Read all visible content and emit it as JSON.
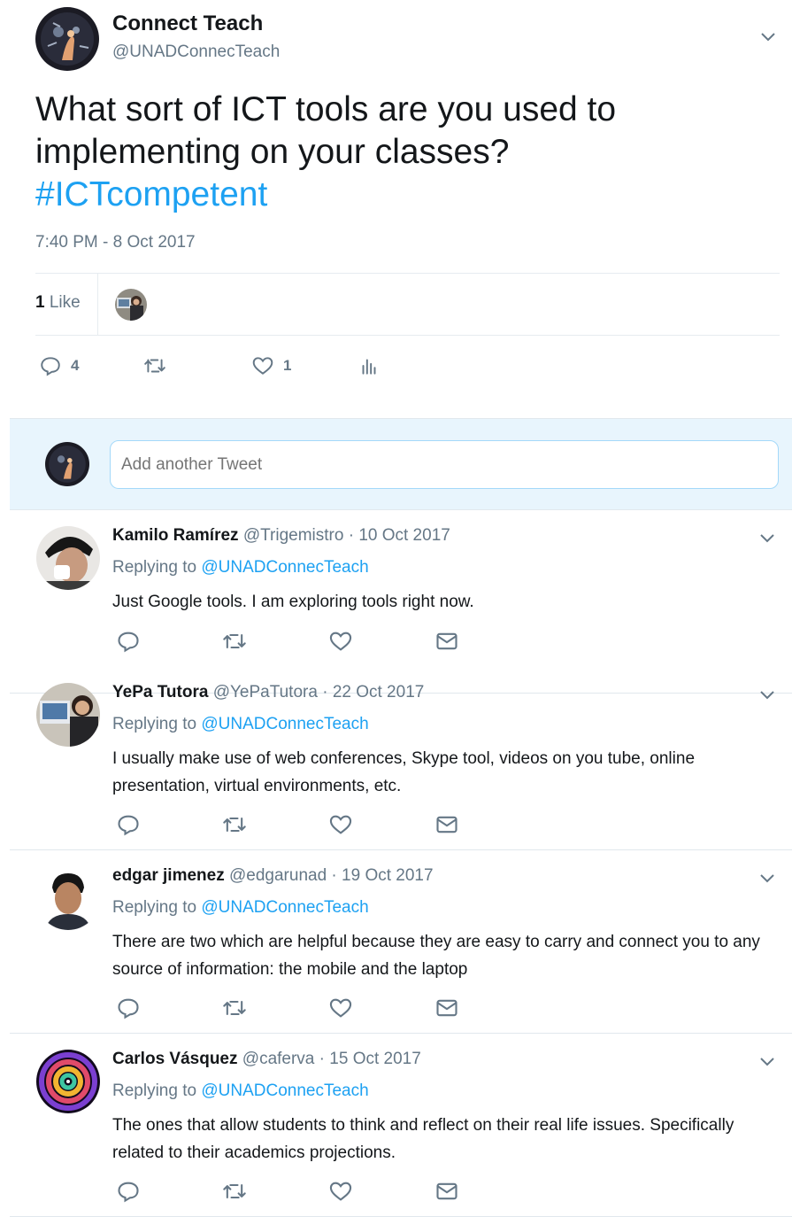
{
  "main_tweet": {
    "author_name": "Connect Teach",
    "author_handle": "@UNADConnecTeach",
    "text": "What sort of ICT tools are you used to implementing on your classes?",
    "hashtag": "#ICTcompetent",
    "timestamp": "7:40 PM - 8 Oct 2017",
    "likes_number": "1",
    "likes_label": " Like",
    "reply_count": "4",
    "like_count": "1"
  },
  "compose": {
    "placeholder": "Add another Tweet"
  },
  "replies": [
    {
      "name": "Kamilo Ramírez",
      "handle": "@Trigemistro",
      "separator": " · ",
      "date": "10 Oct 2017",
      "replying_prefix": "Replying to ",
      "replying_to": "@UNADConnecTeach",
      "text": "Just Google tools. I am exploring tools right now."
    },
    {
      "name": "YePa Tutora",
      "handle": "@YePaTutora",
      "separator": " · ",
      "date": "22 Oct 2017",
      "replying_prefix": "Replying to ",
      "replying_to": "@UNADConnecTeach",
      "text": "I usually make use of web conferences, Skype tool, videos on you tube, online presentation, virtual environments, etc."
    },
    {
      "name": "edgar jimenez",
      "handle": "@edgarunad",
      "separator": " · ",
      "date": "19 Oct 2017",
      "replying_prefix": "Replying to ",
      "replying_to": "@UNADConnecTeach",
      "text": "There are two which are helpful because they are easy to carry and connect you to any source of information: the mobile and the laptop"
    },
    {
      "name": "Carlos Vásquez",
      "handle": "@caferva",
      "separator": " · ",
      "date": "15 Oct 2017",
      "replying_prefix": "Replying to ",
      "replying_to": "@UNADConnecTeach",
      "text": "The ones that allow students to think and reflect on their real life issues. Specifically related to their academics projections."
    }
  ],
  "colors": {
    "accent": "#1da1f2",
    "muted": "#657786",
    "compose_bg": "#e8f5fd"
  },
  "icons": [
    "chevron-down-icon",
    "reply-icon",
    "retweet-icon",
    "like-icon",
    "analytics-icon",
    "direct-message-icon"
  ]
}
